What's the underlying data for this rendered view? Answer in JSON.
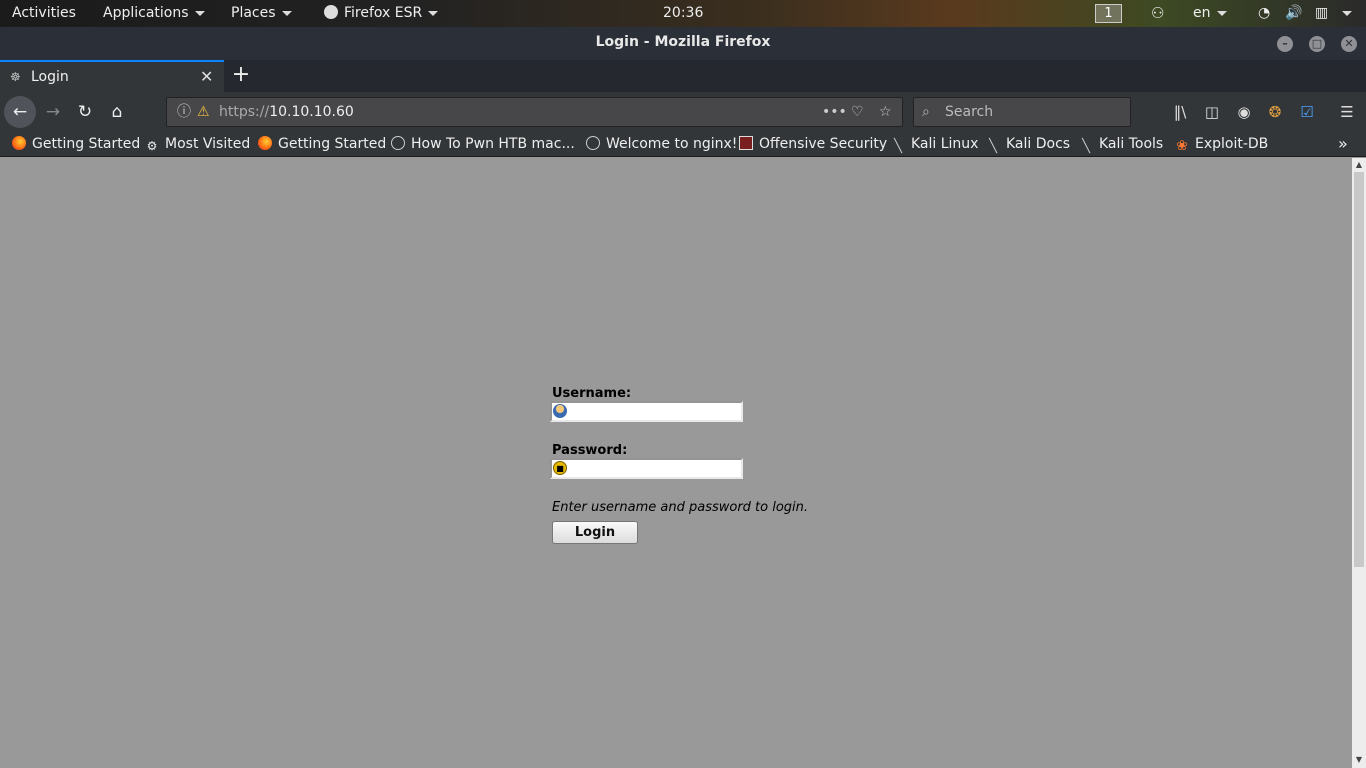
{
  "topbar": {
    "activities": "Activities",
    "applications": "Applications",
    "places": "Places",
    "app": "Firefox ESR",
    "clock": "20:36",
    "workspace": "1",
    "lang": "en",
    "icons": [
      "wifi-icon",
      "volume-icon",
      "battery-icon",
      "power-menu-icon"
    ]
  },
  "window": {
    "title": "Login - Mozilla Firefox"
  },
  "tabs": [
    {
      "label": "Login"
    }
  ],
  "navbar": {
    "url_protocol": "https://",
    "url_host": "10.10.10.60",
    "search_placeholder": "Search"
  },
  "bookmarks": [
    {
      "label": "Getting Started",
      "icon": "firefox-icon"
    },
    {
      "label": "Most Visited",
      "icon": "gear-icon"
    },
    {
      "label": "Getting Started",
      "icon": "firefox-icon"
    },
    {
      "label": "How To Pwn HTB mac...",
      "icon": "globe-icon"
    },
    {
      "label": "Welcome to nginx!",
      "icon": "globe-icon"
    },
    {
      "label": "Offensive Security",
      "icon": "offsec-icon"
    },
    {
      "label": "Kali Linux",
      "icon": "kali-dragon-icon"
    },
    {
      "label": "Kali Docs",
      "icon": "kali-dragon-icon"
    },
    {
      "label": "Kali Tools",
      "icon": "kali-dragon-icon"
    },
    {
      "label": "Exploit-DB",
      "icon": "exploitdb-icon"
    }
  ],
  "login": {
    "username_label": "Username:",
    "username_value": "",
    "password_label": "Password:",
    "password_value": "",
    "hint": "Enter username and password to login.",
    "button": "Login"
  },
  "colors": {
    "page_bg": "#999999",
    "toolbar_bg": "#323639",
    "tab_accent": "#0a84ff"
  }
}
